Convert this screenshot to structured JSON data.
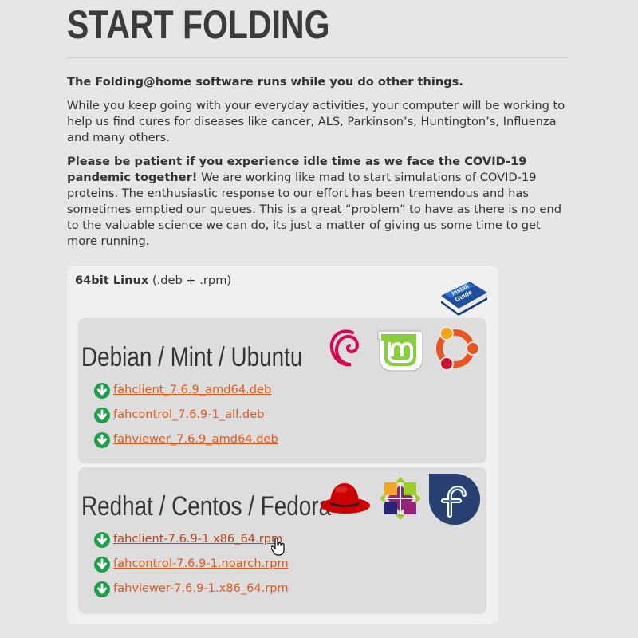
{
  "page": {
    "title": "START FOLDING",
    "intro_bold": "The Folding@home software runs while you do other things.",
    "intro_text": "While you keep going with your everyday activities, your computer will be working to help us find cures for diseases like cancer, ALS, Parkinson’s, Huntington’s, Influenza and many others.",
    "notice_bold": "Please be patient if you experience idle time as we face the COVID-19 pandemic together!",
    "notice_text": " We are working like mad to start simulations of COVID-19 proteins. The enthusiastic response to our effort has been tremendous and has sometimes emptied our queues. This is a great “problem” to have as there is no end to the valuable science we can do, its just a matter of giving us some time to get more running."
  },
  "linux": {
    "label_bold": "64bit Linux",
    "label_rest": " (.deb + .rpm)",
    "install_guide_text": "Install Guide",
    "groups": [
      {
        "title": "Debian / Mint / Ubuntu",
        "logos": [
          "debian-logo",
          "mint-logo",
          "ubuntu-logo"
        ],
        "links": [
          "fahclient_7.6.9_amd64.deb",
          "fahcontrol_7.6.9-1_all.deb",
          "fahviewer_7.6.9_amd64.deb"
        ]
      },
      {
        "title": "Redhat / Centos / Fedora",
        "logos": [
          "redhat-logo",
          "centos-logo",
          "fedora-logo"
        ],
        "links": [
          "fahclient-7.6.9-1.x86_64.rpm",
          "fahcontrol-7.6.9-1.noarch.rpm",
          "fahviewer-7.6.9-1.x86_64.rpm"
        ]
      }
    ]
  },
  "colors": {
    "background": "#e6e6e6",
    "panel": "#f0f0f0",
    "distro_box": "#dddddd",
    "link": "#e05a1c",
    "download_icon": "#1e9e4a"
  }
}
